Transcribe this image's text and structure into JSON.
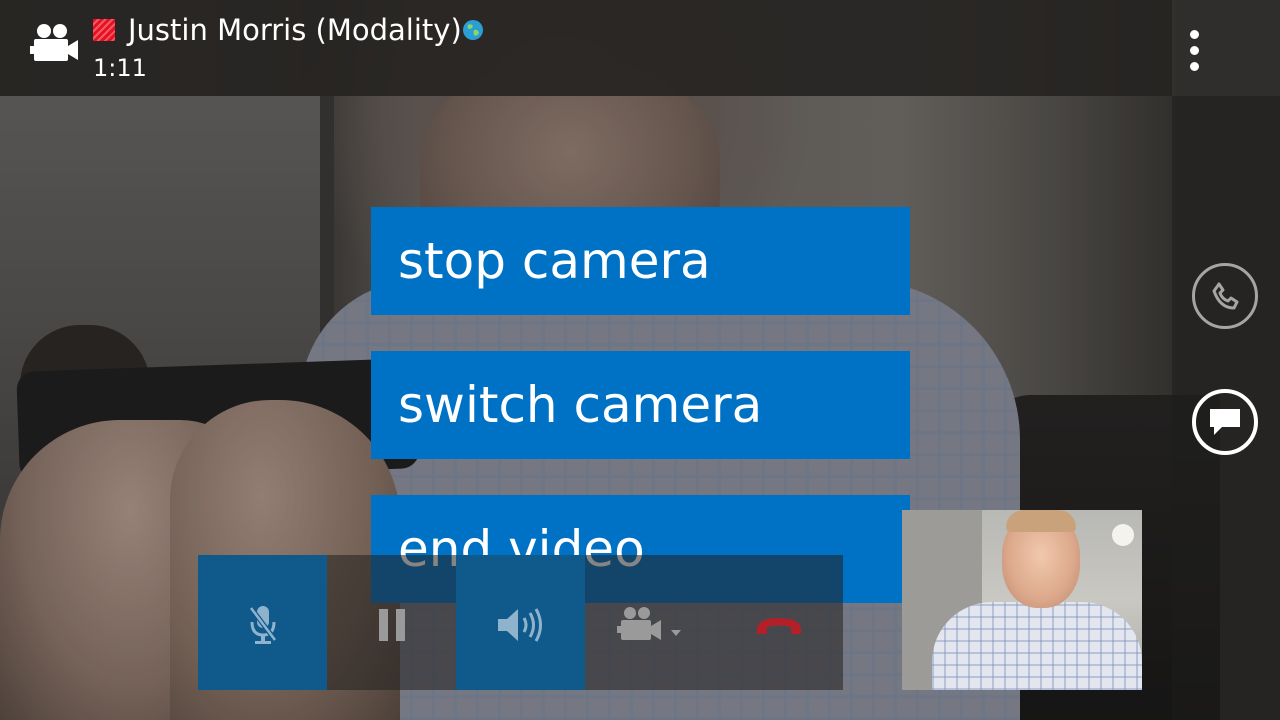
{
  "call": {
    "contact_name": "Justin Morris (Modality)",
    "duration": "1:11",
    "presence_status": "busy",
    "presence_color": "#e81123",
    "call_type_icon": "video-camera-icon",
    "federated_icon": "globe-icon"
  },
  "topbar": {
    "more_icon": "more-dots-icon"
  },
  "side_actions": [
    {
      "icon": "phone-icon",
      "state": "inactive"
    },
    {
      "icon": "chat-icon",
      "state": "active"
    }
  ],
  "menu": {
    "items": [
      "stop camera",
      "switch camera",
      "end video"
    ],
    "accent_color": "#0072c6"
  },
  "controls": [
    {
      "icon": "mic-muted-icon",
      "state": "on"
    },
    {
      "icon": "pause-icon",
      "state": "off"
    },
    {
      "icon": "speaker-icon",
      "state": "on"
    },
    {
      "icon": "video-camera-dropdown-icon",
      "state": "off"
    },
    {
      "icon": "hang-up-icon",
      "state": "off"
    }
  ],
  "self_view": {
    "present": true
  }
}
